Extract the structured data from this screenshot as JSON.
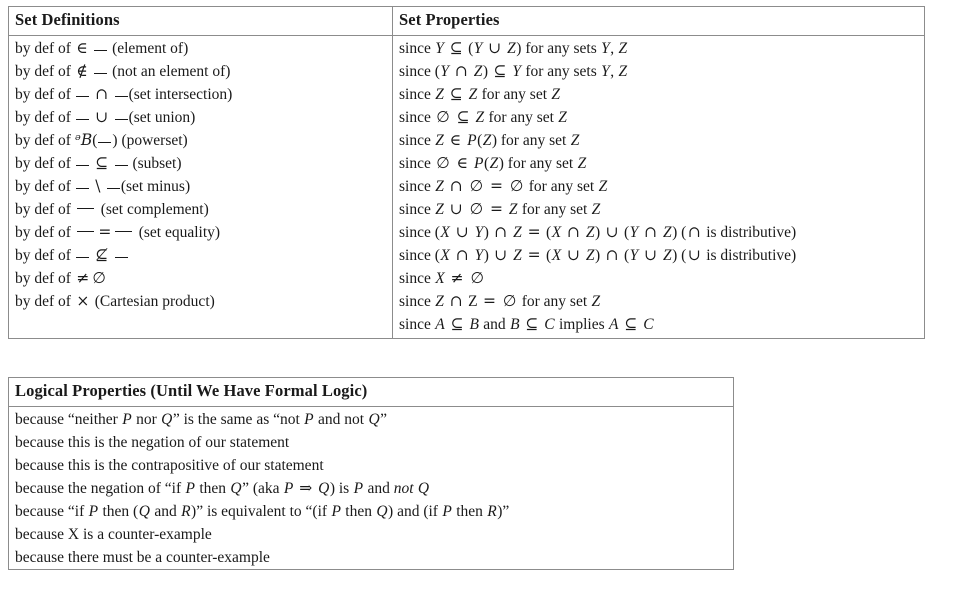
{
  "tables": [
    {
      "name": "set-reference",
      "columns": [
        {
          "header": "Set Definitions",
          "rows": [
            {
              "id": "element-of",
              "prefix": "by def of ",
              "sym": "in",
              "ph": "after",
              "note": "(element of)"
            },
            {
              "id": "not-element-of",
              "prefix": "by def of ",
              "sym": "notin",
              "ph": "after",
              "note": "(not an element of)"
            },
            {
              "id": "intersection",
              "prefix": "by def of ",
              "sym": "cap",
              "ph": "both",
              "note": "(set intersection)",
              "tight": true
            },
            {
              "id": "union",
              "prefix": "by def of ",
              "sym": "cup",
              "ph": "both",
              "note": "(set union)",
              "tight": true
            },
            {
              "id": "powerset",
              "prefix": "by def of ",
              "sym": "powerset",
              "ph": "none",
              "note": "(powerset)"
            },
            {
              "id": "subset",
              "prefix": "by def of ",
              "sym": "subseteq",
              "ph": "both",
              "note": "(subset)"
            },
            {
              "id": "set-minus",
              "prefix": "by def of ",
              "sym": "setminus",
              "ph": "both",
              "note": "(set minus)",
              "tight": true
            },
            {
              "id": "complement",
              "prefix": "by def of ",
              "sym": "bar",
              "ph": "none",
              "note": "(set complement)"
            },
            {
              "id": "set-equality",
              "prefix": "by def of ",
              "sym": "bareqbar",
              "ph": "none",
              "note": "(set equality)"
            },
            {
              "id": "not-subset",
              "prefix": "by def of ",
              "sym": "nsubseteq",
              "ph": "both",
              "note": ""
            },
            {
              "id": "nonempty",
              "prefix": "by def of ",
              "sym": "neqempty",
              "ph": "none",
              "note": ""
            },
            {
              "id": "cartesian-product",
              "prefix": "by def of ",
              "sym": "times",
              "ph": "none",
              "note": "(Cartesian product)"
            }
          ]
        },
        {
          "header": "Set Properties",
          "rows": [
            {
              "id": "union-superset",
              "text": "since Y ⊆ (Y ∪ Z) for any sets Y, Z"
            },
            {
              "id": "intersection-subset",
              "text": "since (Y ∩ Z) ⊆ Y for any sets Y, Z"
            },
            {
              "id": "reflexive-subset",
              "text": "since Z ⊆ Z for any set Z"
            },
            {
              "id": "empty-subset",
              "text": "since ∅ ⊆ Z for any set Z"
            },
            {
              "id": "self-in-powerset",
              "text": "since Z ∈ P(Z) for any set Z"
            },
            {
              "id": "empty-in-powerset",
              "text": "since ∅ ∈ P(Z) for any set Z"
            },
            {
              "id": "intersect-empty",
              "text": "since Z ∩ ∅ = ∅ for any set Z"
            },
            {
              "id": "union-empty",
              "text": "since Z ∪ ∅ = Z for any set Z"
            },
            {
              "id": "intersection-distributive",
              "text": "since (X ∪ Y) ∩ Z = (X ∩ Z) ∪ (Y ∩ Z) (∩ is distributive)"
            },
            {
              "id": "union-distributive",
              "text": "since (X ∩ Y) ∪ Z = (X ∪ Z) ∩ (Y ∪ Z) (∪ is distributive)"
            },
            {
              "id": "x-nonempty",
              "text": "since X ≠ ∅"
            },
            {
              "id": "complement-disjoint",
              "text": "since Z ∩ Z̄ = ∅ for any set Z"
            },
            {
              "id": "subset-transitive",
              "text": "since A ⊆ B and B ⊆ C implies A ⊆ C"
            }
          ]
        }
      ]
    },
    {
      "name": "logical-properties",
      "columns": [
        {
          "header": "Logical Properties (Until We Have Formal Logic)",
          "rows": [
            {
              "id": "de-morgan-nor",
              "text": "because “neither P nor Q” is the same as “not P and not Q”"
            },
            {
              "id": "negation",
              "text": "because this is the negation of our statement"
            },
            {
              "id": "contrapositive",
              "text": "because this is the contrapositive of our statement"
            },
            {
              "id": "negation-implies",
              "text": "because the negation of “if P then Q” (aka P ⇒ Q) is P and not Q"
            },
            {
              "id": "implication-split",
              "text": "because “if P then (Q and R)” is equivalent to “(if P then Q) and (if P then R)”"
            },
            {
              "id": "counter-example",
              "text": "because X is a counter-example"
            },
            {
              "id": "must-be-counter-example",
              "text": "because there must be a counter-example"
            }
          ]
        }
      ]
    }
  ]
}
